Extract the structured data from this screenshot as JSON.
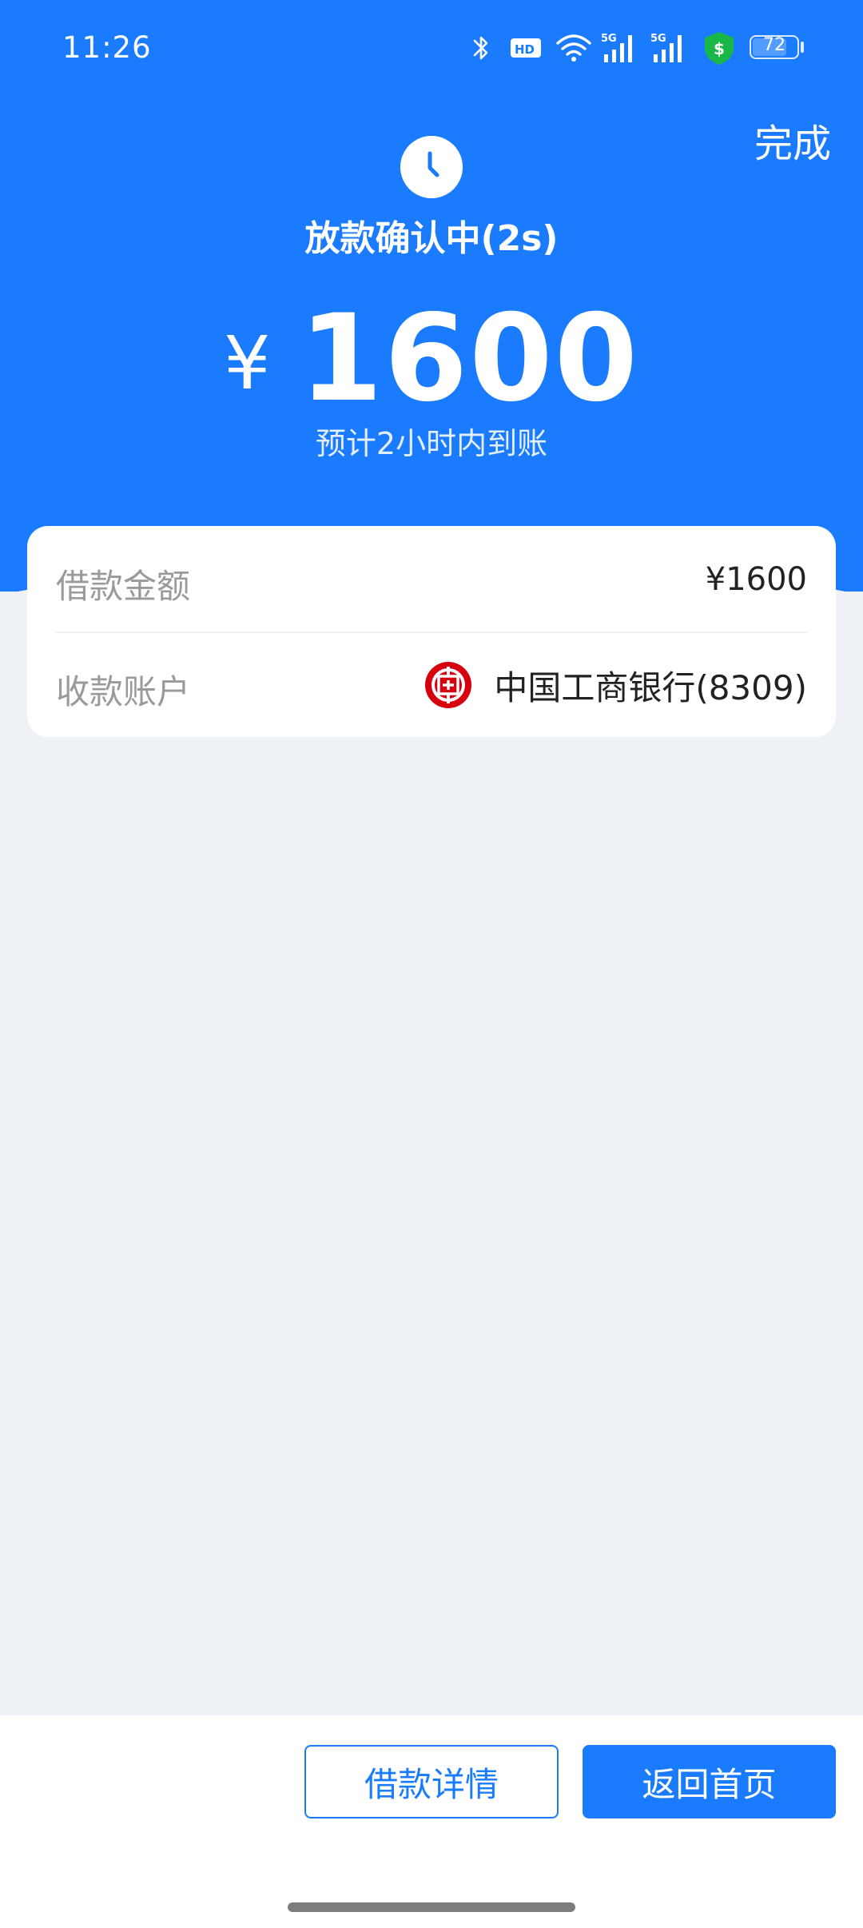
{
  "status_bar": {
    "time": "11:26",
    "battery_level": "72",
    "icons": [
      "bluetooth-icon",
      "hd-icon",
      "wifi-icon",
      "signal-5g-icon",
      "signal-5g-icon",
      "security-shield-icon",
      "battery-icon"
    ]
  },
  "header": {
    "done_label": "完成",
    "status_title": "放款确认中(2s)",
    "currency_symbol": "¥",
    "amount": "1600",
    "eta": "预计2小时内到账",
    "icon": "clock-icon"
  },
  "details": {
    "loan_amount_label": "借款金额",
    "loan_amount_value": "¥1600",
    "account_label": "收款账户",
    "bank_name": "中国工商银行(8309)",
    "bank_icon": "icbc-logo-icon"
  },
  "footer": {
    "detail_button": "借款详情",
    "home_button": "返回首页"
  },
  "colors": {
    "primary": "#1a7bff",
    "background": "#eef1f6",
    "bank_logo": "#d7000f",
    "shield": "#19b648"
  }
}
